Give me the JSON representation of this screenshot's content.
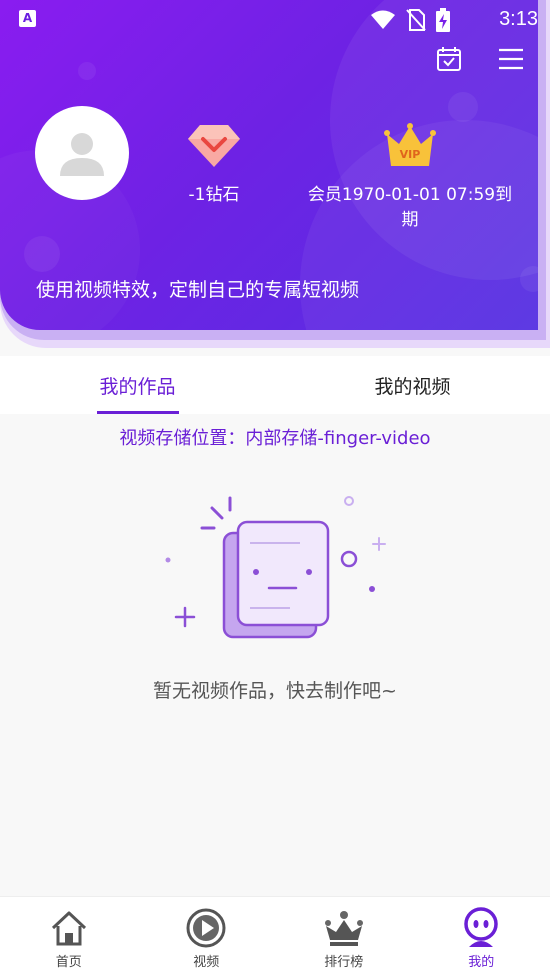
{
  "status_bar": {
    "app_icon_letter": "A",
    "time": "3:13"
  },
  "header": {
    "diamond_text": "-1钻石",
    "vip_badge": "VIP",
    "vip_text": "会员1970-01-01 07:59到期",
    "slogan": "使用视频特效，定制自己的专属短视频"
  },
  "tabs": [
    {
      "label": "我的作品",
      "active": true
    },
    {
      "label": "我的视频",
      "active": false
    }
  ],
  "storage_text": "视频存储位置：内部存储-finger-video",
  "empty_text": "暂无视频作品，快去制作吧~",
  "bottom_nav": [
    {
      "label": "首页",
      "icon": "home-icon",
      "active": false
    },
    {
      "label": "视频",
      "icon": "play-icon",
      "active": false
    },
    {
      "label": "排行榜",
      "icon": "crown-icon",
      "active": false
    },
    {
      "label": "我的",
      "icon": "profile-face-icon",
      "active": true
    }
  ],
  "colors": {
    "accent": "#6a1fd6",
    "header_start": "#8a1cf0",
    "header_end": "#5530e2"
  }
}
